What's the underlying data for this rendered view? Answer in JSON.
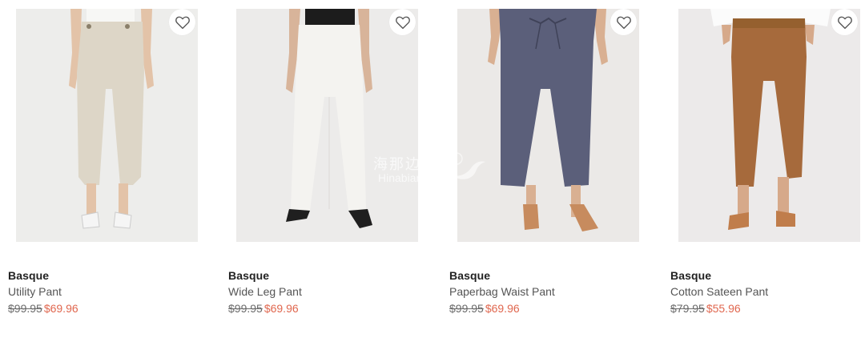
{
  "products": [
    {
      "brand": "Basque",
      "name": "Utility Pant",
      "was_price": "$99.95",
      "now_price": "$69.96",
      "wishlist_icon": "heart-outline-icon"
    },
    {
      "brand": "Basque",
      "name": "Wide Leg Pant",
      "was_price": "$99.95",
      "now_price": "$69.96",
      "wishlist_icon": "heart-outline-icon"
    },
    {
      "brand": "Basque",
      "name": "Paperbag Waist Pant",
      "was_price": "$99.95",
      "now_price": "$69.96",
      "wishlist_icon": "heart-outline-icon"
    },
    {
      "brand": "Basque",
      "name": "Cotton Sateen Pant",
      "was_price": "$79.95",
      "now_price": "$55.96",
      "wishlist_icon": "heart-outline-icon"
    }
  ],
  "watermark": {
    "text_cn": "海那边",
    "text_en": "Hinabian"
  },
  "colors": {
    "sale_price": "#e0674f",
    "was_price": "#6b6b6b",
    "brand": "#222222"
  }
}
